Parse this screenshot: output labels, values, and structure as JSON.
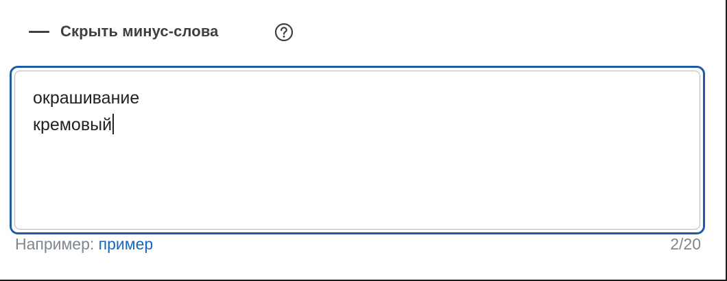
{
  "section": {
    "toggle_label": "Скрыть минус-слова",
    "help_icon": "question-circle-icon"
  },
  "minus_words": {
    "line1": "окрашивание",
    "line2": "кремовый"
  },
  "hint": {
    "prefix": "Например:",
    "example_link": "пример"
  },
  "counter": "2/20",
  "colors": {
    "focus_border": "#1f5aa6",
    "link": "#1a66b8",
    "muted_text": "#80868b"
  }
}
